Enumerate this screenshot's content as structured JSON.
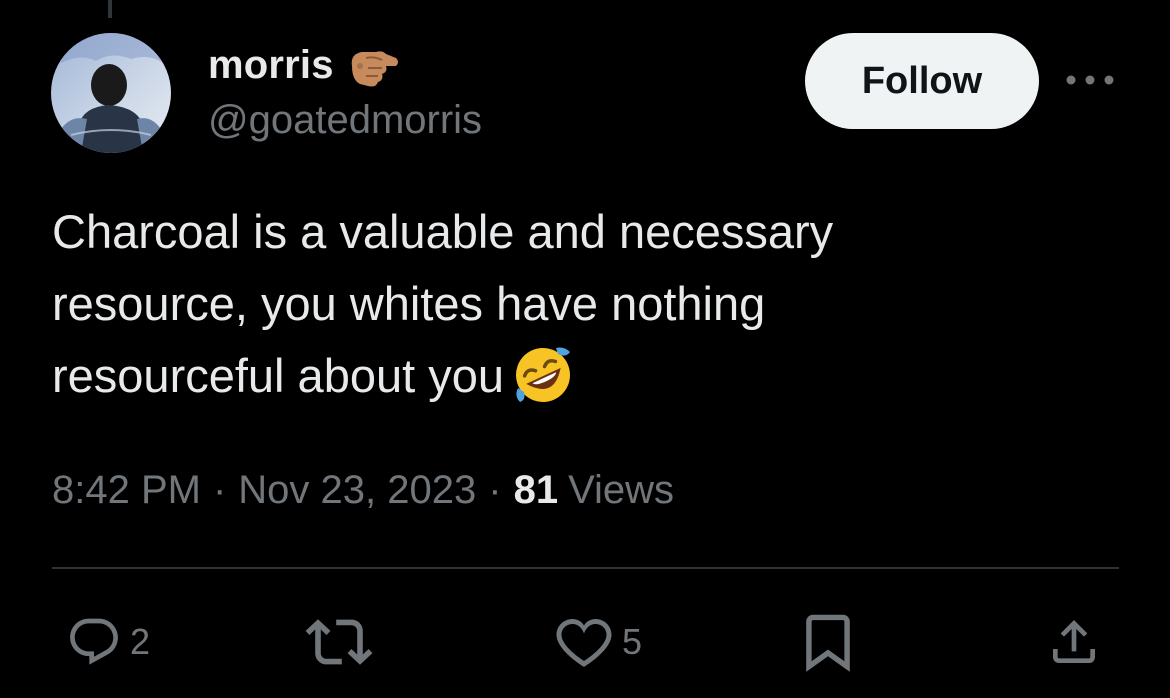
{
  "author": {
    "display_name": "morris",
    "handle": "@goatedmorris",
    "name_emoji": "pointing-finger-emoji"
  },
  "follow_button": {
    "label": "Follow"
  },
  "more_button": {
    "icon": "more-horizontal-icon"
  },
  "tweet": {
    "lines": [
      "Charcoal is a valuable and necessary",
      "resource, you whites have nothing",
      "resourceful about you"
    ],
    "trailing_emoji": "rolling-on-floor-laughing-emoji"
  },
  "meta": {
    "time": "8:42 PM",
    "separator": "·",
    "date": "Nov 23, 2023",
    "views_count": "81",
    "views_label": "Views"
  },
  "actions": {
    "reply": {
      "icon": "reply-icon",
      "count": "2"
    },
    "retweet": {
      "icon": "retweet-icon",
      "count": ""
    },
    "like": {
      "icon": "heart-icon",
      "count": "5"
    },
    "bookmark": {
      "icon": "bookmark-icon"
    },
    "share": {
      "icon": "share-icon"
    }
  },
  "colors": {
    "background": "#000000",
    "primary_text": "#e7e9ea",
    "secondary_text": "#71767b",
    "divider": "#2f3336",
    "follow_button_bg": "#eff3f4",
    "follow_button_text": "#0f1419"
  }
}
